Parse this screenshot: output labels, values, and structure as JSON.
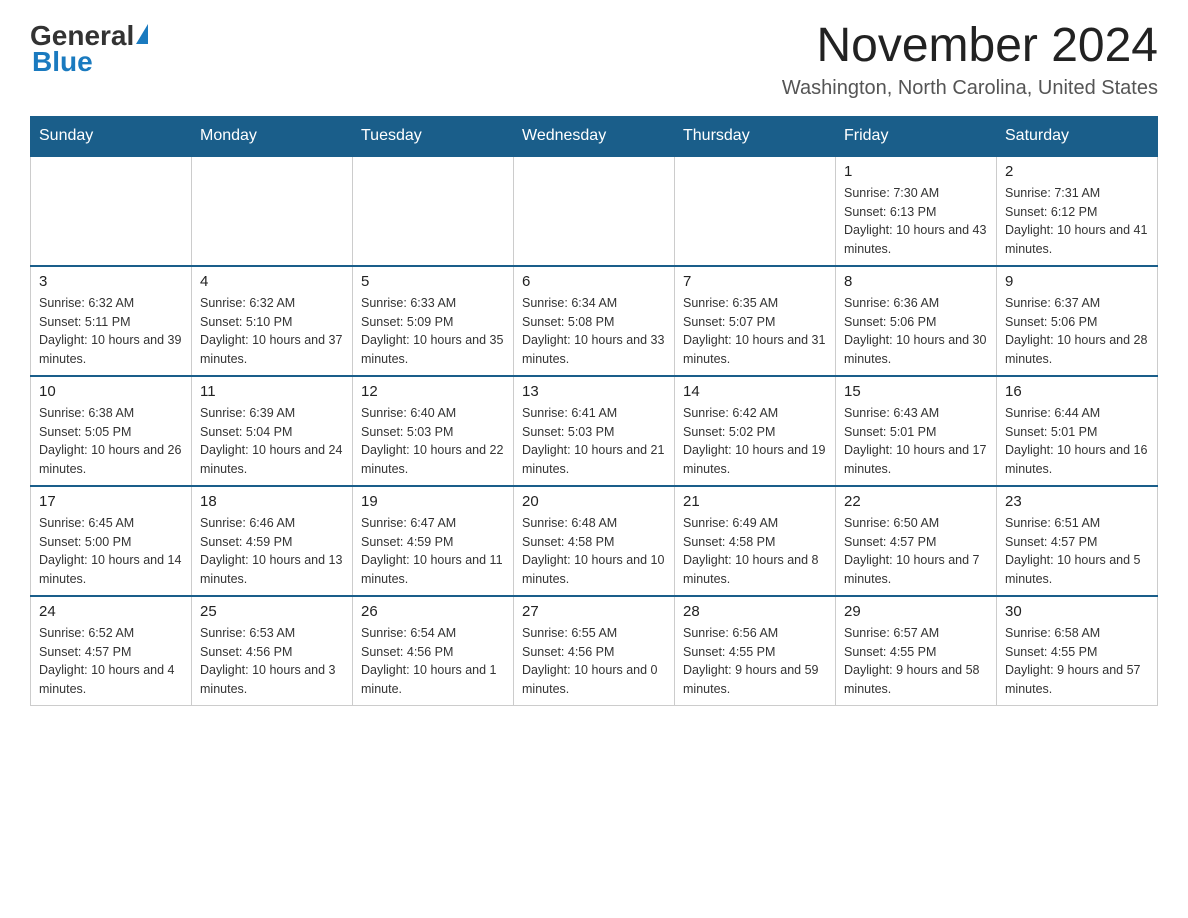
{
  "logo": {
    "general": "General",
    "blue": "Blue"
  },
  "title": "November 2024",
  "subtitle": "Washington, North Carolina, United States",
  "days_of_week": [
    "Sunday",
    "Monday",
    "Tuesday",
    "Wednesday",
    "Thursday",
    "Friday",
    "Saturday"
  ],
  "weeks": [
    [
      {
        "day": "",
        "info": ""
      },
      {
        "day": "",
        "info": ""
      },
      {
        "day": "",
        "info": ""
      },
      {
        "day": "",
        "info": ""
      },
      {
        "day": "",
        "info": ""
      },
      {
        "day": "1",
        "info": "Sunrise: 7:30 AM\nSunset: 6:13 PM\nDaylight: 10 hours and 43 minutes."
      },
      {
        "day": "2",
        "info": "Sunrise: 7:31 AM\nSunset: 6:12 PM\nDaylight: 10 hours and 41 minutes."
      }
    ],
    [
      {
        "day": "3",
        "info": "Sunrise: 6:32 AM\nSunset: 5:11 PM\nDaylight: 10 hours and 39 minutes."
      },
      {
        "day": "4",
        "info": "Sunrise: 6:32 AM\nSunset: 5:10 PM\nDaylight: 10 hours and 37 minutes."
      },
      {
        "day": "5",
        "info": "Sunrise: 6:33 AM\nSunset: 5:09 PM\nDaylight: 10 hours and 35 minutes."
      },
      {
        "day": "6",
        "info": "Sunrise: 6:34 AM\nSunset: 5:08 PM\nDaylight: 10 hours and 33 minutes."
      },
      {
        "day": "7",
        "info": "Sunrise: 6:35 AM\nSunset: 5:07 PM\nDaylight: 10 hours and 31 minutes."
      },
      {
        "day": "8",
        "info": "Sunrise: 6:36 AM\nSunset: 5:06 PM\nDaylight: 10 hours and 30 minutes."
      },
      {
        "day": "9",
        "info": "Sunrise: 6:37 AM\nSunset: 5:06 PM\nDaylight: 10 hours and 28 minutes."
      }
    ],
    [
      {
        "day": "10",
        "info": "Sunrise: 6:38 AM\nSunset: 5:05 PM\nDaylight: 10 hours and 26 minutes."
      },
      {
        "day": "11",
        "info": "Sunrise: 6:39 AM\nSunset: 5:04 PM\nDaylight: 10 hours and 24 minutes."
      },
      {
        "day": "12",
        "info": "Sunrise: 6:40 AM\nSunset: 5:03 PM\nDaylight: 10 hours and 22 minutes."
      },
      {
        "day": "13",
        "info": "Sunrise: 6:41 AM\nSunset: 5:03 PM\nDaylight: 10 hours and 21 minutes."
      },
      {
        "day": "14",
        "info": "Sunrise: 6:42 AM\nSunset: 5:02 PM\nDaylight: 10 hours and 19 minutes."
      },
      {
        "day": "15",
        "info": "Sunrise: 6:43 AM\nSunset: 5:01 PM\nDaylight: 10 hours and 17 minutes."
      },
      {
        "day": "16",
        "info": "Sunrise: 6:44 AM\nSunset: 5:01 PM\nDaylight: 10 hours and 16 minutes."
      }
    ],
    [
      {
        "day": "17",
        "info": "Sunrise: 6:45 AM\nSunset: 5:00 PM\nDaylight: 10 hours and 14 minutes."
      },
      {
        "day": "18",
        "info": "Sunrise: 6:46 AM\nSunset: 4:59 PM\nDaylight: 10 hours and 13 minutes."
      },
      {
        "day": "19",
        "info": "Sunrise: 6:47 AM\nSunset: 4:59 PM\nDaylight: 10 hours and 11 minutes."
      },
      {
        "day": "20",
        "info": "Sunrise: 6:48 AM\nSunset: 4:58 PM\nDaylight: 10 hours and 10 minutes."
      },
      {
        "day": "21",
        "info": "Sunrise: 6:49 AM\nSunset: 4:58 PM\nDaylight: 10 hours and 8 minutes."
      },
      {
        "day": "22",
        "info": "Sunrise: 6:50 AM\nSunset: 4:57 PM\nDaylight: 10 hours and 7 minutes."
      },
      {
        "day": "23",
        "info": "Sunrise: 6:51 AM\nSunset: 4:57 PM\nDaylight: 10 hours and 5 minutes."
      }
    ],
    [
      {
        "day": "24",
        "info": "Sunrise: 6:52 AM\nSunset: 4:57 PM\nDaylight: 10 hours and 4 minutes."
      },
      {
        "day": "25",
        "info": "Sunrise: 6:53 AM\nSunset: 4:56 PM\nDaylight: 10 hours and 3 minutes."
      },
      {
        "day": "26",
        "info": "Sunrise: 6:54 AM\nSunset: 4:56 PM\nDaylight: 10 hours and 1 minute."
      },
      {
        "day": "27",
        "info": "Sunrise: 6:55 AM\nSunset: 4:56 PM\nDaylight: 10 hours and 0 minutes."
      },
      {
        "day": "28",
        "info": "Sunrise: 6:56 AM\nSunset: 4:55 PM\nDaylight: 9 hours and 59 minutes."
      },
      {
        "day": "29",
        "info": "Sunrise: 6:57 AM\nSunset: 4:55 PM\nDaylight: 9 hours and 58 minutes."
      },
      {
        "day": "30",
        "info": "Sunrise: 6:58 AM\nSunset: 4:55 PM\nDaylight: 9 hours and 57 minutes."
      }
    ]
  ]
}
